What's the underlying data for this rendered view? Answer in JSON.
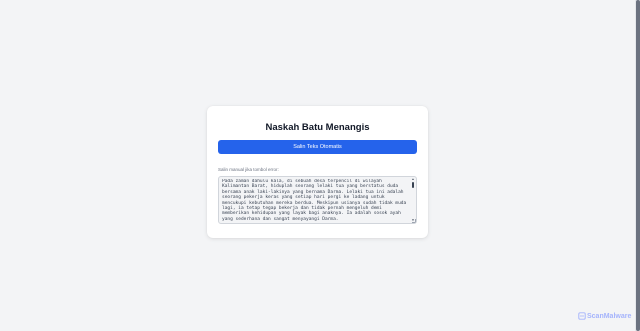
{
  "card": {
    "title": "Naskah Batu Menangis",
    "copy_button_label": "Salin Teks Otomatis",
    "manual_label": "Salin manual jika tombol error:",
    "story_text": "Pada zaman dahulu kala, di sebuah desa terpencil di wilayah Kalimantan Barat, hiduplah seorang lelaki tua yang berstatus duda bersama anak laki-lakinya yang bernama Darma. Lelaki tua ini adalah seorang pekerja keras yang setiap hari pergi ke ladang untuk mencukupi kebutuhan mereka berdua. Meskipun usianya sudah tidak muda lagi, ia tetap tegap bekerja dan tidak pernah mengeluh demi memberikan kehidupan yang layak bagi anaknya. Ia adalah sosok ayah yang sederhana dan sangat menyayangi Darma."
  },
  "watermark": {
    "text": "ScanMalware",
    "icon": "scanmalware-logo-icon"
  },
  "colors": {
    "accent": "#2563eb",
    "background": "#f3f4f6",
    "watermark": "#a5b4fc"
  }
}
